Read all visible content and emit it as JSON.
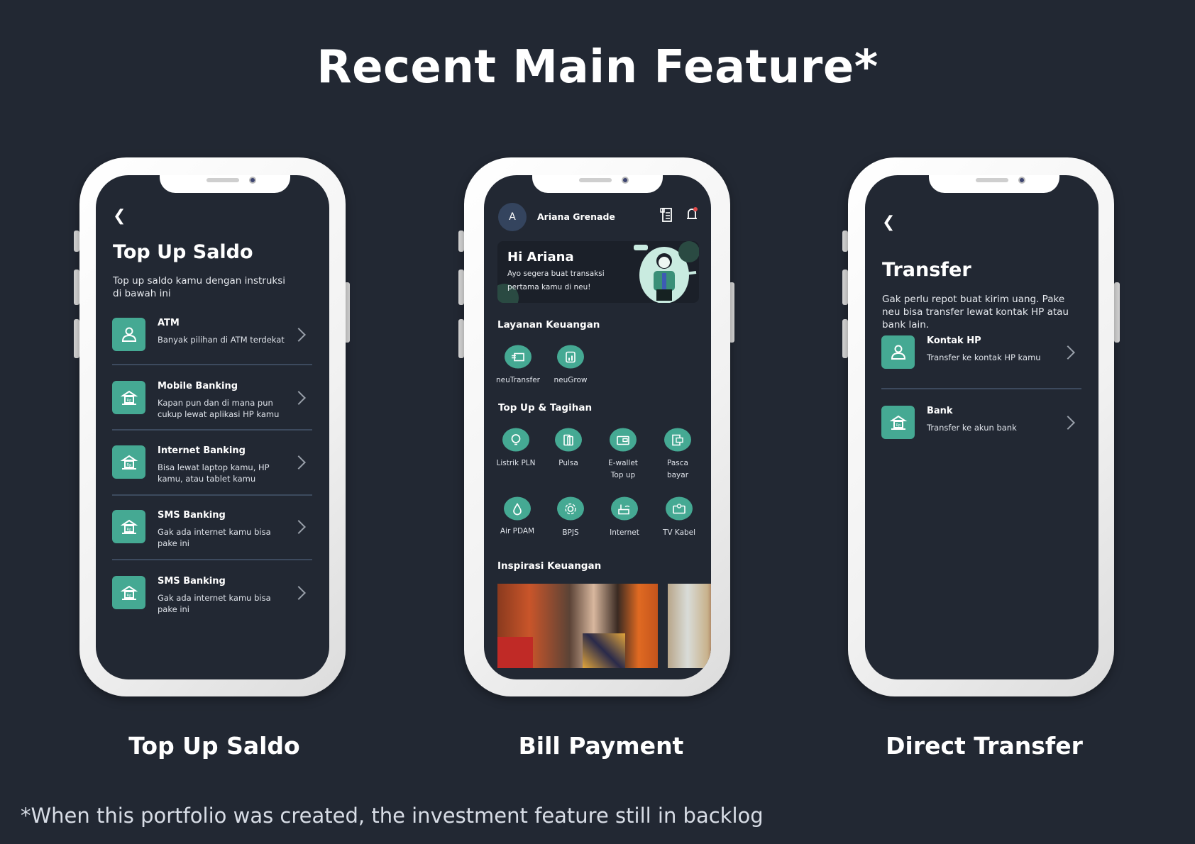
{
  "title": "Recent Main Feature*",
  "footnote": "*When this portfolio was created, the investment feature still in backlog",
  "colors": {
    "background": "#222833",
    "accent": "#45a993",
    "phone_frame": "#f4f4f4"
  },
  "phones": [
    {
      "caption": "Top Up Saldo",
      "screen": {
        "title": "Top Up Saldo",
        "description": "Top up saldo kamu dengan instruksi di bawah ini",
        "items": [
          {
            "title": "ATM",
            "desc": "Banyak pilihan di ATM terdekat",
            "icon": "person-icon"
          },
          {
            "title": "Mobile Banking",
            "desc": "Kapan pun dan di mana pun cukup lewat aplikasi HP kamu",
            "icon": "bank-icon"
          },
          {
            "title": "Internet Banking",
            "desc": "Bisa lewat laptop kamu, HP kamu, atau tablet kamu",
            "icon": "bank-icon"
          },
          {
            "title": "SMS Banking",
            "desc": "Gak ada internet kamu bisa pake ini",
            "icon": "bank-icon"
          },
          {
            "title": "SMS Banking",
            "desc": "Gak ada internet kamu bisa pake ini",
            "icon": "bank-icon"
          }
        ]
      }
    },
    {
      "caption": "Bill Payment",
      "screen": {
        "avatar_initial": "A",
        "user_name": "Ariana Grenade",
        "banner": {
          "title": "Hi Ariana",
          "text": "Ayo segera buat transaksi pertama kamu di neu!"
        },
        "section1": "Layanan Keuangan",
        "services": [
          "neuTransfer",
          "neuGrow"
        ],
        "section2": "Top Up & Tagihan",
        "bills": [
          "Listrik PLN",
          "Pulsa",
          "E-wallet Top up",
          "Pasca bayar",
          "Air PDAM",
          "BPJS",
          "Internet",
          "TV Kabel"
        ],
        "section3": "Inspirasi Keuangan"
      }
    },
    {
      "caption": "Direct Transfer",
      "screen": {
        "title": "Transfer",
        "description": "Gak perlu repot buat kirim uang. Pake neu bisa transfer lewat kontak HP atau bank lain.",
        "items": [
          {
            "title": "Kontak HP",
            "desc": "Transfer ke kontak HP kamu",
            "icon": "person-icon"
          },
          {
            "title": "Bank",
            "desc": "Transfer ke akun bank",
            "icon": "bank-icon"
          }
        ]
      }
    }
  ]
}
